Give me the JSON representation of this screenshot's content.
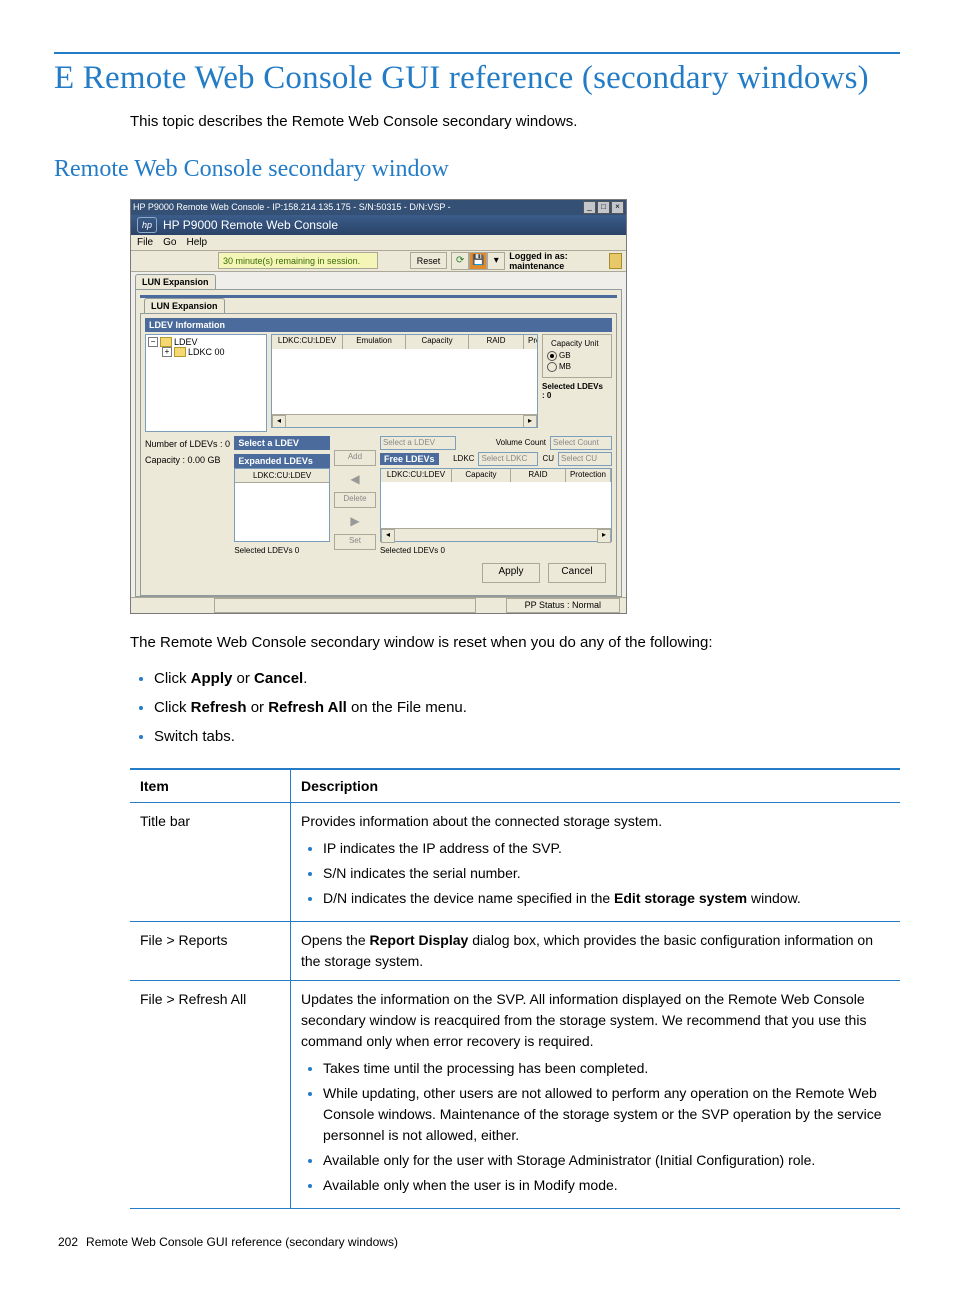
{
  "page": {
    "main_heading": "E Remote Web Console GUI reference (secondary windows)",
    "intro": "This topic describes the Remote Web Console secondary windows.",
    "sub_heading": "Remote Web Console secondary window",
    "reset_intro": "The Remote Web Console secondary window is reset when you do any of the following:",
    "bullets": {
      "b1_pre": "Click ",
      "b1_bold1": "Apply",
      "b1_mid": " or ",
      "b1_bold2": "Cancel",
      "b1_post": ".",
      "b2_pre": "Click ",
      "b2_bold1": "Refresh",
      "b2_mid": " or ",
      "b2_bold2": "Refresh All",
      "b2_post": " on the File menu.",
      "b3": "Switch tabs."
    },
    "footer_num": "202",
    "footer_text": "Remote Web Console GUI reference (secondary windows)"
  },
  "screenshot": {
    "titlebar": "HP P9000 Remote Web Console - IP:158.214.135.175 - S/N:50315 - D/N:VSP -",
    "brand": "HP P9000 Remote Web Console",
    "menu": {
      "file": "File",
      "go": "Go",
      "help": "Help"
    },
    "session": "30 minute(s) remaining in session.",
    "reset": "Reset",
    "login": "Logged in as: maintenance",
    "tab_main": "LUN Expansion",
    "tab_sub": "LUN Expansion",
    "ldev_info": "LDEV Information",
    "tree": {
      "root": "LDEV",
      "child": "LDKC 00"
    },
    "grid_cols": {
      "c1": "LDKC:CU:LDEV",
      "c2": "Emulation",
      "c3": "Capacity",
      "c4": "RAID",
      "c5": "Protec"
    },
    "cap_unit": {
      "title": "Capacity Unit",
      "gb": "GB",
      "mb": "MB"
    },
    "selected_ldevs_side": {
      "label": "Selected LDEVs",
      "val": ": 0"
    },
    "stats": {
      "num_ldevs": "Number of LDEVs  : 0",
      "capacity": "Capacity    : 0.00 GB"
    },
    "select_ldev_bar": "Select a LDEV",
    "expanded_ldevs_bar": "Expanded LDEVs",
    "small_head": "LDKC:CU:LDEV",
    "select_ldev_gray": "Select a LDEV",
    "volume_count": "Volume Count",
    "select_count": "Select Count",
    "free_ldevs": "Free LDEVs",
    "ldkc_label": "LDKC",
    "ldkc_sel": "Select LDKC",
    "cu_label": "CU",
    "cu_sel": "Select CU",
    "free_cols": {
      "c1": "LDKC:CU:LDEV",
      "c2": "Capacity",
      "c3": "RAID",
      "c4": "Protection"
    },
    "btns": {
      "add": "Add",
      "delete": "Delete",
      "set": "Set"
    },
    "sel_bottom_left": "Selected LDEVs  0",
    "sel_bottom_right": "Selected LDEVs  0",
    "apply": "Apply",
    "cancel": "Cancel",
    "pp_status": "PP Status : Normal"
  },
  "table": {
    "h1": "Item",
    "h2": "Description",
    "r1": {
      "item": "Title bar",
      "desc": "Provides information about the connected storage system.",
      "l1": "IP indicates the IP address of the SVP.",
      "l2": "S/N indicates the serial number.",
      "l3_pre": "D/N indicates the device name specified in the ",
      "l3_bold": "Edit storage system",
      "l3_post": " window."
    },
    "r2": {
      "item": "File > Reports",
      "d_pre": "Opens the ",
      "d_bold": "Report Display",
      "d_post": " dialog box, which provides the basic configuration information on the storage system."
    },
    "r3": {
      "item": "File > Refresh All",
      "desc": "Updates the information on the SVP. All information displayed on the Remote Web Console secondary window is reacquired from the storage system. We recommend that you use this command only when error recovery is required.",
      "l1": "Takes time until the processing has been completed.",
      "l2": "While updating, other users are not allowed to perform any operation on the Remote Web Console windows. Maintenance of the storage system or the SVP operation by the service personnel is not allowed, either.",
      "l3": "Available only for the user with Storage Administrator (Initial Configuration) role.",
      "l4": "Available only when the user is in Modify mode."
    }
  }
}
